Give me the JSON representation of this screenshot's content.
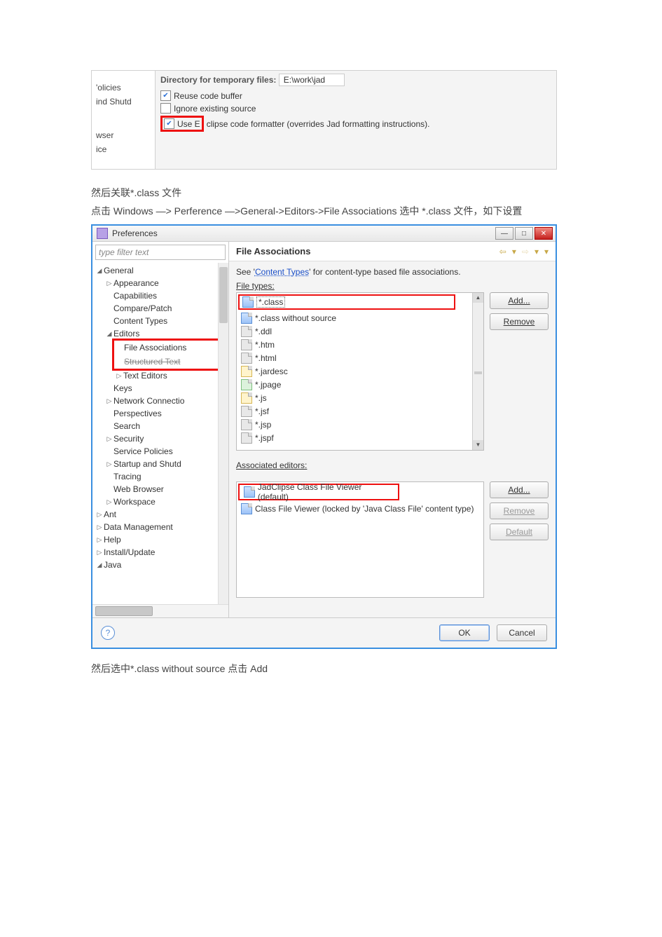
{
  "snap1": {
    "left_items": [
      "'olicies",
      "ind Shutd",
      "",
      "wser",
      "ice"
    ],
    "dir_label": "Directory for temporary files:",
    "dir_value": "E:\\work\\jad",
    "cb1": "Reuse code buffer",
    "cb2": "Ignore existing source",
    "cb3a": "Use E",
    "cb3b": "clipse code formatter (overrides Jad formatting instructions)."
  },
  "text1": "然后关联*.class 文件",
  "text2": "点击 Windows —> Perference —>General->Editors->File  Associations  选中  *.class  文件，如下设置",
  "dialog": {
    "title": "Preferences",
    "filter_placeholder": "type filter text",
    "tree": [
      {
        "tw": "◢",
        "lbl": "General",
        "cls": ""
      },
      {
        "tw": "▷",
        "lbl": "Appearance",
        "cls": "ind1"
      },
      {
        "tw": "",
        "lbl": "Capabilities",
        "cls": "ind1"
      },
      {
        "tw": "",
        "lbl": "Compare/Patch",
        "cls": "ind1"
      },
      {
        "tw": "",
        "lbl": "Content Types",
        "cls": "ind1"
      },
      {
        "tw": "◢",
        "lbl": "Editors",
        "cls": "ind1"
      },
      {
        "tw": "",
        "lbl": "File Associations",
        "cls": "ind2 boxA"
      },
      {
        "tw": "",
        "lbl": "Structured Text",
        "cls": "ind2 boxB"
      },
      {
        "tw": "▷",
        "lbl": "Text Editors",
        "cls": "ind2"
      },
      {
        "tw": "",
        "lbl": "Keys",
        "cls": "ind1"
      },
      {
        "tw": "▷",
        "lbl": "Network Connectio",
        "cls": "ind1"
      },
      {
        "tw": "",
        "lbl": "Perspectives",
        "cls": "ind1"
      },
      {
        "tw": "",
        "lbl": "Search",
        "cls": "ind1"
      },
      {
        "tw": "▷",
        "lbl": "Security",
        "cls": "ind1"
      },
      {
        "tw": "",
        "lbl": "Service Policies",
        "cls": "ind1"
      },
      {
        "tw": "▷",
        "lbl": "Startup and Shutd",
        "cls": "ind1"
      },
      {
        "tw": "",
        "lbl": "Tracing",
        "cls": "ind1"
      },
      {
        "tw": "",
        "lbl": "Web Browser",
        "cls": "ind1"
      },
      {
        "tw": "▷",
        "lbl": "Workspace",
        "cls": "ind1"
      },
      {
        "tw": "▷",
        "lbl": "Ant",
        "cls": ""
      },
      {
        "tw": "▷",
        "lbl": "Data Management",
        "cls": ""
      },
      {
        "tw": "▷",
        "lbl": "Help",
        "cls": ""
      },
      {
        "tw": "▷",
        "lbl": "Install/Update",
        "cls": ""
      },
      {
        "tw": "◢",
        "lbl": "Java",
        "cls": ""
      }
    ],
    "header_title": "File Associations",
    "see_pre": "See '",
    "see_link": "Content Types",
    "see_post": "' for content-type based file associations.",
    "ft_label": "File types:",
    "file_types": [
      {
        "t": "*.class",
        "ico": "ico-blue",
        "sel": true
      },
      {
        "t": "*.class without source",
        "ico": "ico-blue"
      },
      {
        "t": "*.ddl",
        "ico": "ico-gray"
      },
      {
        "t": "*.htm",
        "ico": "ico-gray"
      },
      {
        "t": "*.html",
        "ico": "ico-gray"
      },
      {
        "t": "*.jardesc",
        "ico": "ico-yellow"
      },
      {
        "t": "*.jpage",
        "ico": "ico-green"
      },
      {
        "t": "*.js",
        "ico": "ico-yellow"
      },
      {
        "t": "*.jsf",
        "ico": "ico-gray"
      },
      {
        "t": "*.jsp",
        "ico": "ico-gray"
      },
      {
        "t": "*.jspf",
        "ico": "ico-gray"
      }
    ],
    "add_label": "Add...",
    "remove_label": "Remove",
    "assoc_label": "Associated editors:",
    "editors": [
      {
        "t": "JadClipse Class File Viewer (default)",
        "sel": true
      },
      {
        "t": "Class File Viewer (locked by 'Java Class File' content type)"
      }
    ],
    "default_label": "Default",
    "ok": "OK",
    "cancel": "Cancel"
  },
  "text3": "然后选中*.class  without  source 点击 Add"
}
